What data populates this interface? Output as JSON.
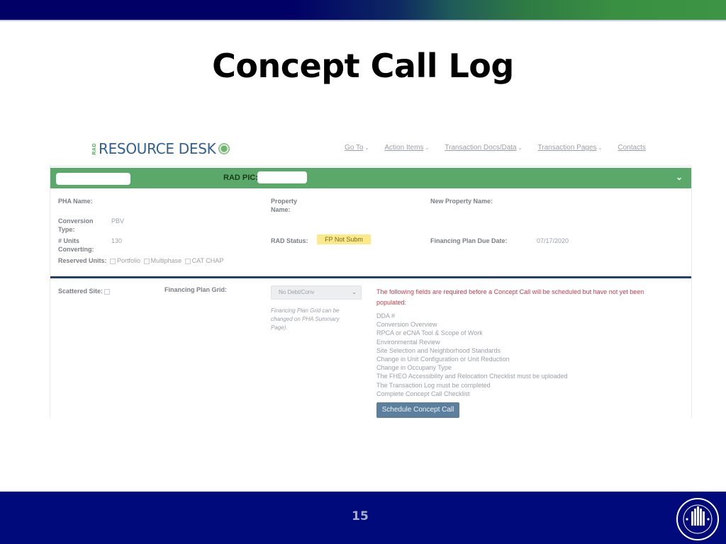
{
  "slide": {
    "title": "Concept Call Log",
    "page_number": "15",
    "logo": "hud-seal-icon"
  },
  "app": {
    "logo_prefix": "RAD",
    "logo_text": "RESOURCE DESK",
    "nav": [
      {
        "label": "Go To",
        "has_dropdown": true
      },
      {
        "label": "Action Items",
        "has_dropdown": true
      },
      {
        "label": "Transaction Docs/Data",
        "has_dropdown": true
      },
      {
        "label": "Transaction Pages",
        "has_dropdown": true
      },
      {
        "label": "Contacts",
        "has_dropdown": false
      }
    ]
  },
  "card": {
    "header": {
      "rad_pic_label": "RAD PIC:",
      "colors": {
        "bar": "#5aa86a"
      }
    },
    "fields": {
      "pha_name_label": "PHA Name:",
      "property_name_label": "Property Name:",
      "new_property_name_label": "New Property Name:",
      "conversion_type_label": "Conversion Type:",
      "conversion_type_value": "PBV",
      "units_converting_label": "# Units Converting:",
      "units_converting_value": "130",
      "rad_status_label": "RAD Status:",
      "rad_status_value": "FP Not Subm",
      "fp_due_date_label": "Financing Plan Due Date:",
      "fp_due_date_value": "07/17/2020",
      "reserved_units_label": "Reserved Units:",
      "reserved_options": [
        "Portfolio",
        "Multiphase",
        "CAT CHAP"
      ]
    },
    "lower": {
      "scattered_site_label": "Scattered Site:",
      "financing_plan_grid_label": "Financing Plan Grid:",
      "financing_plan_grid_value": "No Debt/Conv",
      "financing_plan_note": "Financing Plan Grid can be changed on PHA Summary Page).",
      "required_message": "The following fields are required before a Concept Call will be scheduled but have not yet been populated:",
      "required_items": [
        "DDA #",
        "Conversion Overview",
        "RPCA or eCNA Tool & Scope of Work",
        "Environmental Review",
        "Site Selection and Neighborhood Standards",
        "Change in Unit Configuration or Unit Reduction",
        "Change in Occupany Type",
        "The FHEO Accessibility and Relocation Checklist must be uploaded",
        "The Transaction Log must be completed",
        "Complete Concept Call Checklist"
      ],
      "schedule_button": "Schedule Concept Call"
    }
  }
}
